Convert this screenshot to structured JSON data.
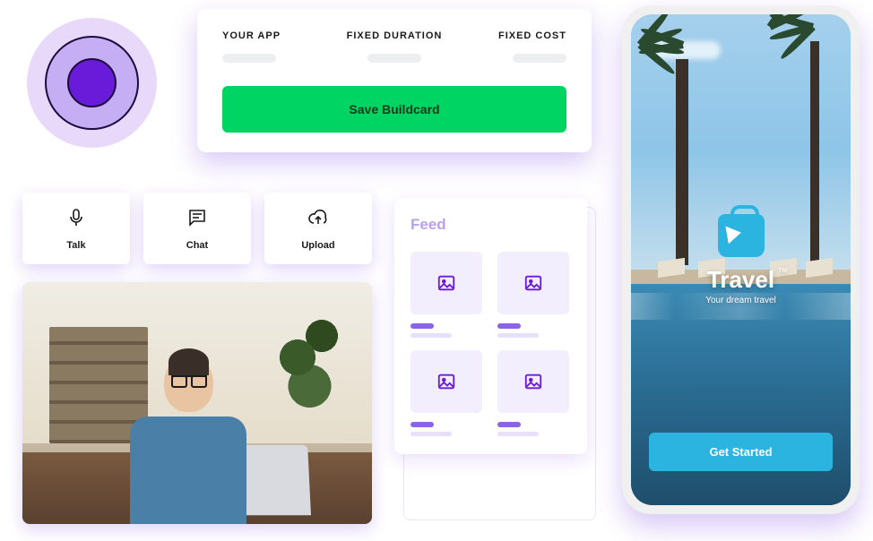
{
  "colors": {
    "purple": "#6a1bd9",
    "purple_light": "#c5aef3",
    "green": "#00d462",
    "cyan": "#2bb4e0"
  },
  "buildcard": {
    "columns": [
      {
        "label": "YOUR APP"
      },
      {
        "label": "FIXED DURATION"
      },
      {
        "label": "FIXED COST"
      }
    ],
    "save_label": "Save Buildcard"
  },
  "actions": {
    "talk": {
      "label": "Talk",
      "icon": "mic-icon"
    },
    "chat": {
      "label": "Chat",
      "icon": "chat-icon"
    },
    "upload": {
      "label": "Upload",
      "icon": "cloud-upload-icon"
    }
  },
  "feed": {
    "title": "Feed"
  },
  "phone": {
    "brand": "Travel",
    "trademark": "TM",
    "subtitle": "Your dream travel",
    "cta": "Get Started"
  }
}
